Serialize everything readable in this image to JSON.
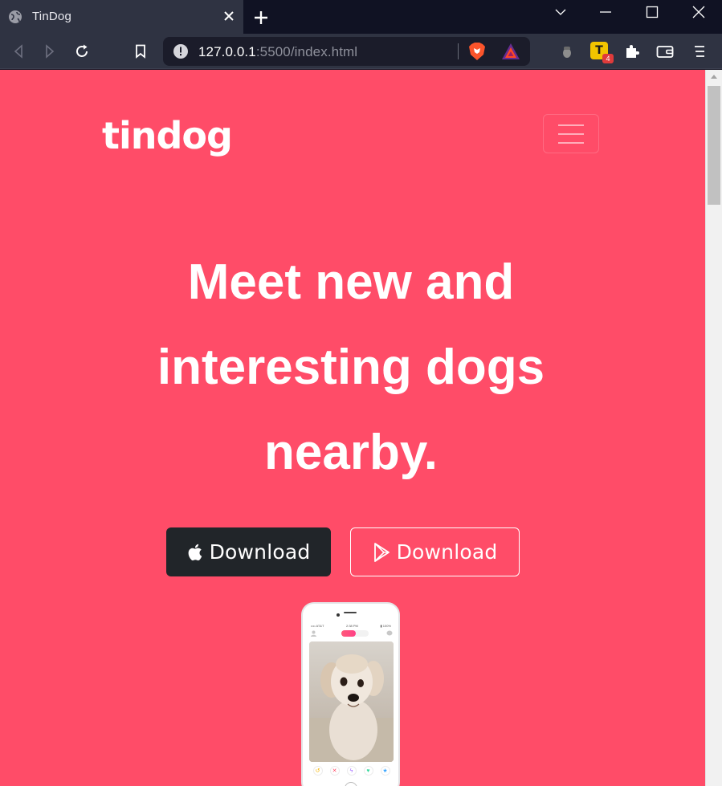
{
  "browser": {
    "tab_title": "TinDog",
    "url_host": "127.0.0.1",
    "url_rest": ":5500/index.html",
    "extension_badge": "T",
    "extension_count": "4"
  },
  "navbar": {
    "brand": "tindog"
  },
  "hero": {
    "title": "Meet new and interesting dogs nearby.",
    "apple_download": "Download",
    "google_download": "Download"
  },
  "colors": {
    "page_background": "#ff4c68",
    "dark_button": "#212529",
    "browser_chrome": "#2f3342"
  },
  "icons": [
    "globe-icon",
    "close-icon",
    "plus-icon",
    "chevron-down-icon",
    "minimize-icon",
    "maximize-icon",
    "back-icon",
    "forward-icon",
    "reload-icon",
    "bookmark-icon",
    "info-icon",
    "brave-lion-icon",
    "bat-triangle-icon",
    "wallet-icon",
    "puzzle-icon",
    "menu-icon",
    "apple-icon",
    "google-play-icon"
  ]
}
